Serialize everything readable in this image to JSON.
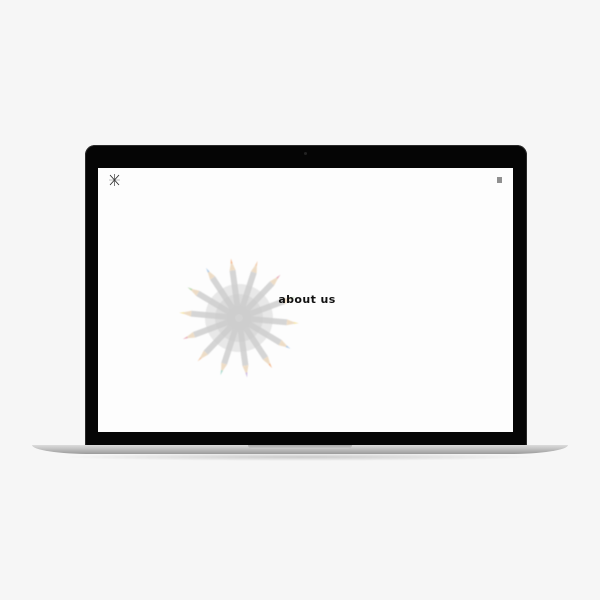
{
  "header": {
    "logo_icon": "crossed-pencils-logo-icon",
    "menu_icon": "hamburger-menu-icon"
  },
  "hero": {
    "title": "about us",
    "image": "colored-pencils-in-cup-image"
  },
  "colors": {
    "bezel": "#050505",
    "screen_background": "#fdfdfd",
    "page_background": "#f6f6f6",
    "title_text": "#111111"
  }
}
